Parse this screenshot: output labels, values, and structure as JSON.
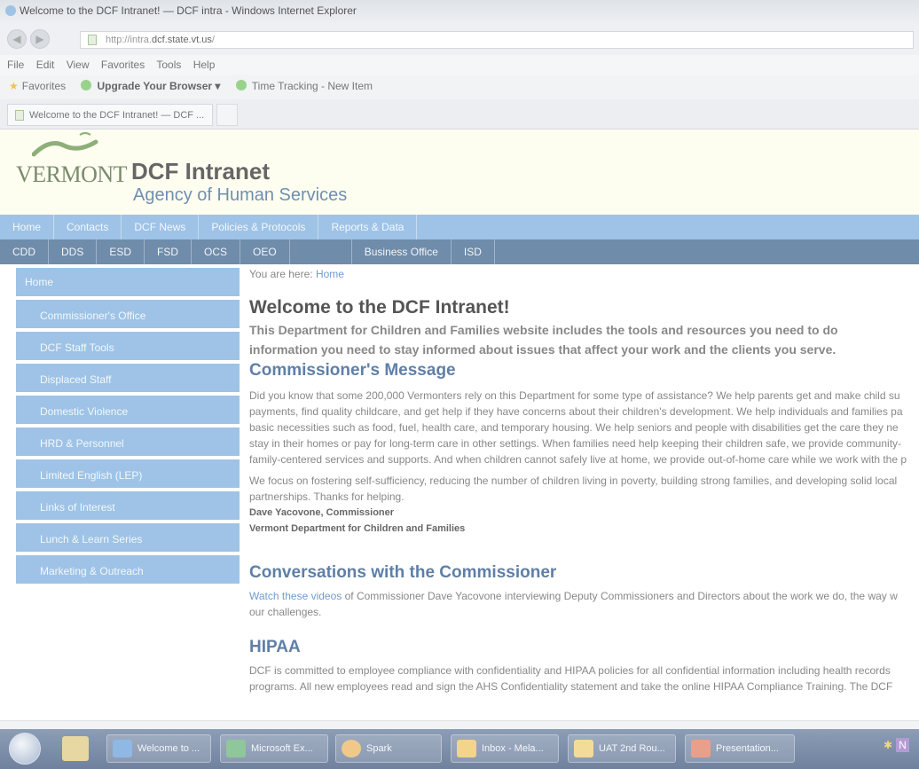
{
  "browser": {
    "window_title": "Welcome to the DCF Intranet! — DCF intra - Windows Internet Explorer",
    "url_prefix": "http://intra.",
    "url_host": "dcf.state.vt.us",
    "url_suffix": "/",
    "menu": [
      "File",
      "Edit",
      "View",
      "Favorites",
      "Tools",
      "Help"
    ],
    "favorites_label": "Favorites",
    "fav_upgrade": "Upgrade Your Browser ▾",
    "fav_timetracking": "Time Tracking - New Item",
    "tab_title": "Welcome to the DCF Intranet! — DCF ..."
  },
  "header": {
    "vermont": "VERMONT",
    "title": "DCF Intranet",
    "subtitle": "Agency of Human Services"
  },
  "topnav": [
    "Home",
    "Contacts",
    "DCF News",
    "Policies & Protocols",
    "Reports & Data"
  ],
  "subnav": {
    "left": [
      "CDD",
      "DDS",
      "ESD",
      "FSD",
      "OCS",
      "OEO"
    ],
    "right": [
      "Business Office",
      "ISD"
    ]
  },
  "sidebar": {
    "home": "Home",
    "items": [
      "Commissioner's Office",
      "DCF Staff Tools",
      "Displaced Staff",
      "Domestic Violence",
      "HRD & Personnel",
      "Limited English (LEP)",
      "Links of Interest",
      "Lunch & Learn Series",
      "Marketing & Outreach"
    ]
  },
  "main": {
    "crumb_prefix": "You are here: ",
    "crumb_link": "Home",
    "heading": "Welcome to the DCF Intranet!",
    "lead1": "This Department for Children and Families website includes the tools and resources you need to do",
    "lead2": "information you need to stay informed about issues that affect your work and the clients you serve.",
    "msg_heading": "Commissioner's Message",
    "msg_lines": [
      "Did you know that some 200,000 Vermonters rely on this Department for some type of assistance? We help parents get and make child su",
      "payments, find quality childcare, and get help if they have concerns about their children's development. We help individuals and families pa",
      "basic necessities such as food, fuel, health care, and temporary housing. We help seniors and people with disabilities get the care they ne",
      "stay in their homes or pay for long-term care in other settings. When families need help keeping their children safe, we provide community-",
      "family-centered services and supports. And when children cannot safely live at home, we provide out-of-home care while we work with the p"
    ],
    "para2_lines": [
      "We focus on fostering self-sufficiency, reducing the number of children living in poverty, building strong families, and developing solid local",
      "partnerships. Thanks for helping."
    ],
    "sig_name": "Dave Yacovone, Commissioner",
    "sig_org": "Vermont Department for Children and Families",
    "conv_heading": "Conversations with the Commissioner",
    "conv_link": "Watch these videos",
    "conv_line1_rest": " of Commissioner Dave Yacovone interviewing Deputy Commissioners and Directors about the work we do, the way w",
    "conv_line2": "our challenges.",
    "hipaa_heading": "HIPAA",
    "hipaa_lines": [
      "DCF is committed to employee compliance with confidentiality and HIPAA policies for all confidential information including health records",
      "programs. All new employees read and sign the AHS Confidentiality statement and take the online HIPAA Compliance Training. The DCF"
    ]
  },
  "taskbar": {
    "items": [
      "Welcome to ...",
      "Microsoft Ex...",
      "Spark",
      "Inbox - Mela...",
      "UAT 2nd Rou...",
      "Presentation..."
    ],
    "tray_letter": "N"
  },
  "colors": {
    "nav_light": "#9ec3e6",
    "nav_dark": "#6f8caa",
    "header_bg": "#fefef0",
    "heading_blue": "#5f7fa8",
    "link_blue": "#6f9ccc"
  }
}
